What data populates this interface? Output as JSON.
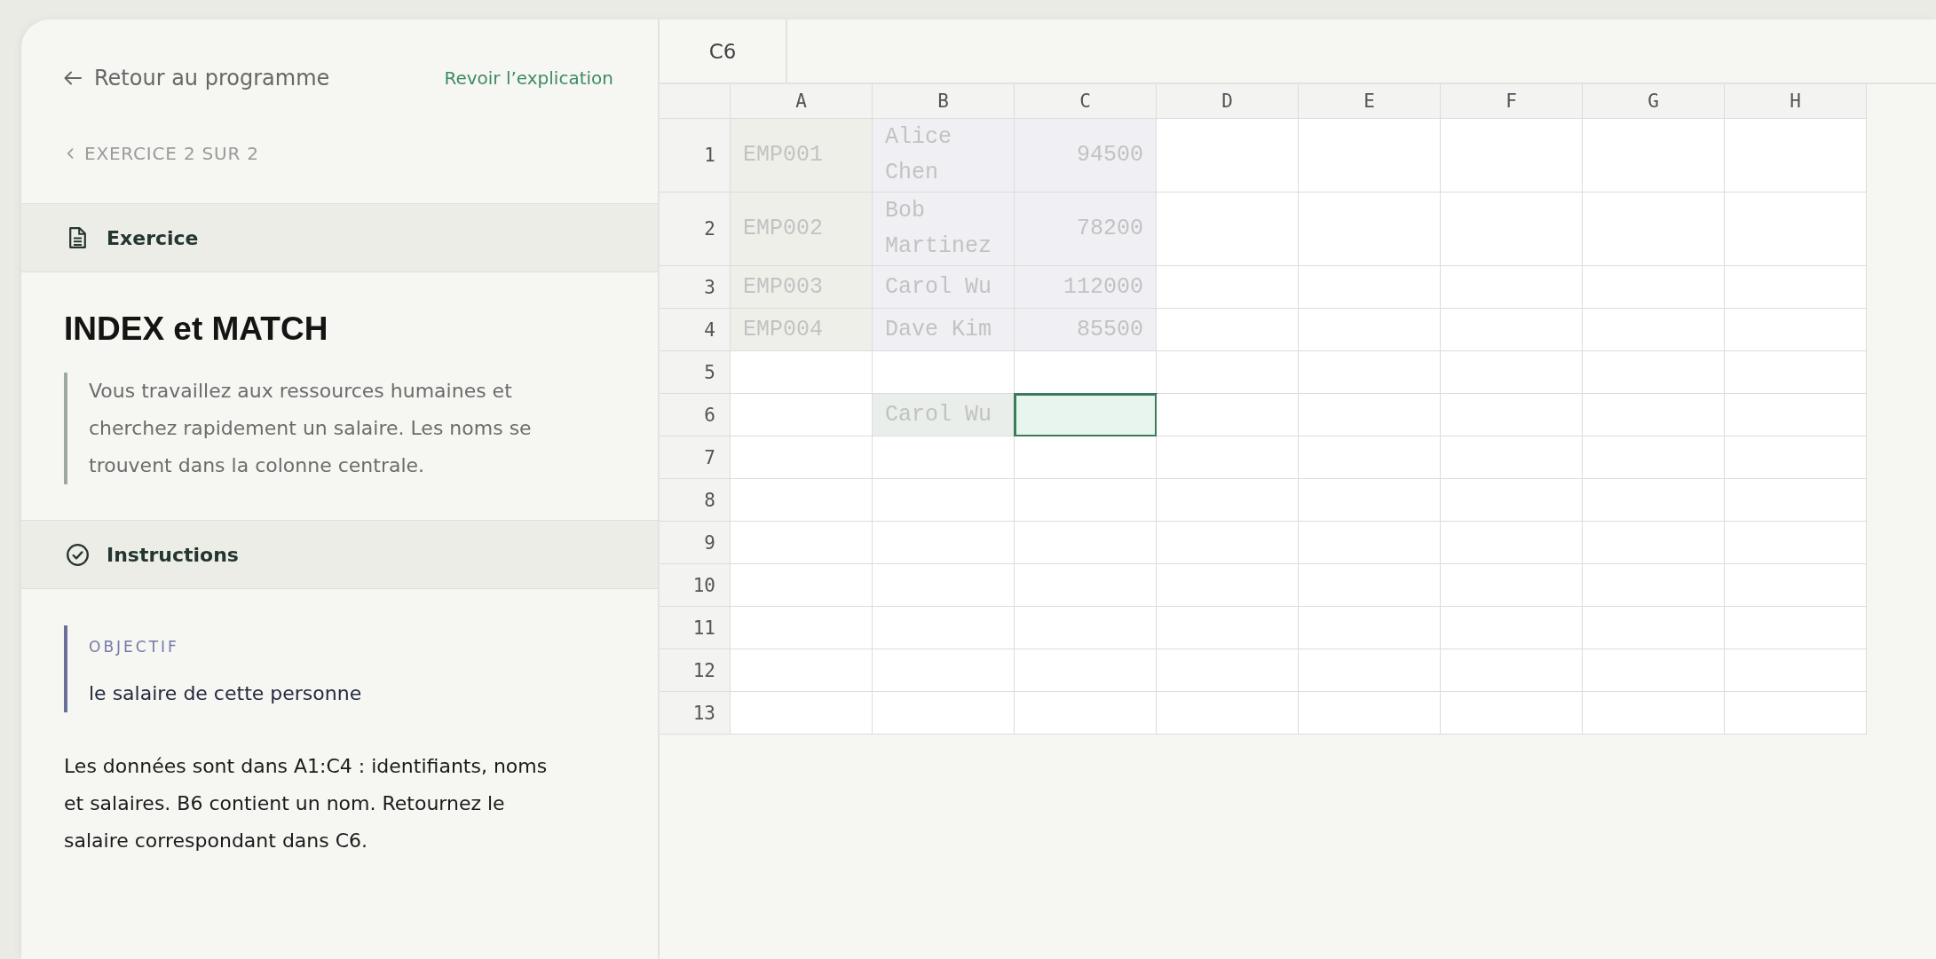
{
  "navigation": {
    "back_link": "Retour au programme",
    "explanation_link": "Revoir l’explication",
    "exercise_counter": "EXERCICE 2 SUR 2"
  },
  "exercise_section": {
    "title": "Exercice",
    "heading": "INDEX et MATCH",
    "context": "Vous travaillez aux ressources humaines et cherchez rapidement un salaire. Les noms se trouvent dans la colonne centrale."
  },
  "instructions_section": {
    "title": "Instructions",
    "objective_label": "OBJECTIF",
    "objective": "le salaire de cette personne",
    "description": "Les données sont dans A1:C4 : identifiants, noms et salaires. B6 contient un nom. Retournez le salaire correspondant dans C6."
  },
  "spreadsheet": {
    "name_box": "C6",
    "columns": [
      "A",
      "B",
      "C",
      "D",
      "E",
      "F",
      "G",
      "H"
    ],
    "rows": [
      {
        "label": "1",
        "cells": [
          {
            "kind": "id",
            "text": "EMP001",
            "selected": false
          },
          {
            "kind": "text",
            "text": "Alice Chen",
            "selected": false
          },
          {
            "kind": "number",
            "text": "94500",
            "selected": false
          },
          {
            "kind": "empty",
            "selected": false
          },
          {
            "kind": "empty",
            "selected": false
          },
          {
            "kind": "empty",
            "selected": false
          },
          {
            "kind": "empty",
            "selected": false
          },
          {
            "kind": "empty",
            "selected": false
          }
        ]
      },
      {
        "label": "2",
        "cells": [
          {
            "kind": "id",
            "text": "EMP002",
            "selected": false
          },
          {
            "kind": "text",
            "text": "Bob Martinez",
            "selected": false
          },
          {
            "kind": "number",
            "text": "78200",
            "selected": false
          },
          {
            "kind": "empty",
            "selected": false
          },
          {
            "kind": "empty",
            "selected": false
          },
          {
            "kind": "empty",
            "selected": false
          },
          {
            "kind": "empty",
            "selected": false
          },
          {
            "kind": "empty",
            "selected": false
          }
        ]
      },
      {
        "label": "3",
        "cells": [
          {
            "kind": "id",
            "text": "EMP003",
            "selected": false
          },
          {
            "kind": "text",
            "text": "Carol Wu",
            "selected": false
          },
          {
            "kind": "number",
            "text": "112000",
            "selected": false
          },
          {
            "kind": "empty",
            "selected": false
          },
          {
            "kind": "empty",
            "selected": false
          },
          {
            "kind": "empty",
            "selected": false
          },
          {
            "kind": "empty",
            "selected": false
          },
          {
            "kind": "empty",
            "selected": false
          }
        ]
      },
      {
        "label": "4",
        "cells": [
          {
            "kind": "id",
            "text": "EMP004",
            "selected": false
          },
          {
            "kind": "text",
            "text": "Dave Kim",
            "selected": false
          },
          {
            "kind": "number",
            "text": "85500",
            "selected": false
          },
          {
            "kind": "empty",
            "selected": false
          },
          {
            "kind": "empty",
            "selected": false
          },
          {
            "kind": "empty",
            "selected": false
          },
          {
            "kind": "empty",
            "selected": false
          },
          {
            "kind": "empty",
            "selected": false
          }
        ]
      },
      {
        "label": "5",
        "cells": [
          {
            "kind": "empty",
            "selected": false
          },
          {
            "kind": "empty",
            "selected": false
          },
          {
            "kind": "empty",
            "selected": false
          },
          {
            "kind": "empty",
            "selected": false
          },
          {
            "kind": "empty",
            "selected": false
          },
          {
            "kind": "empty",
            "selected": false
          },
          {
            "kind": "empty",
            "selected": false
          },
          {
            "kind": "empty",
            "selected": false
          }
        ]
      },
      {
        "label": "6",
        "cells": [
          {
            "kind": "empty",
            "selected": false
          },
          {
            "kind": "lookup",
            "text": "Carol Wu",
            "selected": false
          },
          {
            "kind": "empty",
            "selected": true
          },
          {
            "kind": "empty",
            "selected": false
          },
          {
            "kind": "empty",
            "selected": false
          },
          {
            "kind": "empty",
            "selected": false
          },
          {
            "kind": "empty",
            "selected": false
          },
          {
            "kind": "empty",
            "selected": false
          }
        ]
      },
      {
        "label": "7",
        "cells": [
          {
            "kind": "empty",
            "selected": false
          },
          {
            "kind": "empty",
            "selected": false
          },
          {
            "kind": "empty",
            "selected": false
          },
          {
            "kind": "empty",
            "selected": false
          },
          {
            "kind": "empty",
            "selected": false
          },
          {
            "kind": "empty",
            "selected": false
          },
          {
            "kind": "empty",
            "selected": false
          },
          {
            "kind": "empty",
            "selected": false
          }
        ]
      },
      {
        "label": "8",
        "cells": [
          {
            "kind": "empty",
            "selected": false
          },
          {
            "kind": "empty",
            "selected": false
          },
          {
            "kind": "empty",
            "selected": false
          },
          {
            "kind": "empty",
            "selected": false
          },
          {
            "kind": "empty",
            "selected": false
          },
          {
            "kind": "empty",
            "selected": false
          },
          {
            "kind": "empty",
            "selected": false
          },
          {
            "kind": "empty",
            "selected": false
          }
        ]
      },
      {
        "label": "9",
        "cells": [
          {
            "kind": "empty",
            "selected": false
          },
          {
            "kind": "empty",
            "selected": false
          },
          {
            "kind": "empty",
            "selected": false
          },
          {
            "kind": "empty",
            "selected": false
          },
          {
            "kind": "empty",
            "selected": false
          },
          {
            "kind": "empty",
            "selected": false
          },
          {
            "kind": "empty",
            "selected": false
          },
          {
            "kind": "empty",
            "selected": false
          }
        ]
      },
      {
        "label": "10",
        "cells": [
          {
            "kind": "empty",
            "selected": false
          },
          {
            "kind": "empty",
            "selected": false
          },
          {
            "kind": "empty",
            "selected": false
          },
          {
            "kind": "empty",
            "selected": false
          },
          {
            "kind": "empty",
            "selected": false
          },
          {
            "kind": "empty",
            "selected": false
          },
          {
            "kind": "empty",
            "selected": false
          },
          {
            "kind": "empty",
            "selected": false
          }
        ]
      },
      {
        "label": "11",
        "cells": [
          {
            "kind": "empty",
            "selected": false
          },
          {
            "kind": "empty",
            "selected": false
          },
          {
            "kind": "empty",
            "selected": false
          },
          {
            "kind": "empty",
            "selected": false
          },
          {
            "kind": "empty",
            "selected": false
          },
          {
            "kind": "empty",
            "selected": false
          },
          {
            "kind": "empty",
            "selected": false
          },
          {
            "kind": "empty",
            "selected": false
          }
        ]
      },
      {
        "label": "12",
        "cells": [
          {
            "kind": "empty",
            "selected": false
          },
          {
            "kind": "empty",
            "selected": false
          },
          {
            "kind": "empty",
            "selected": false
          },
          {
            "kind": "empty",
            "selected": false
          },
          {
            "kind": "empty",
            "selected": false
          },
          {
            "kind": "empty",
            "selected": false
          },
          {
            "kind": "empty",
            "selected": false
          },
          {
            "kind": "empty",
            "selected": false
          }
        ]
      },
      {
        "label": "13",
        "cells": [
          {
            "kind": "empty",
            "selected": false
          },
          {
            "kind": "empty",
            "selected": false
          },
          {
            "kind": "empty",
            "selected": false
          },
          {
            "kind": "empty",
            "selected": false
          },
          {
            "kind": "empty",
            "selected": false
          },
          {
            "kind": "empty",
            "selected": false
          },
          {
            "kind": "empty",
            "selected": false
          },
          {
            "kind": "empty",
            "selected": false
          }
        ]
      }
    ]
  }
}
